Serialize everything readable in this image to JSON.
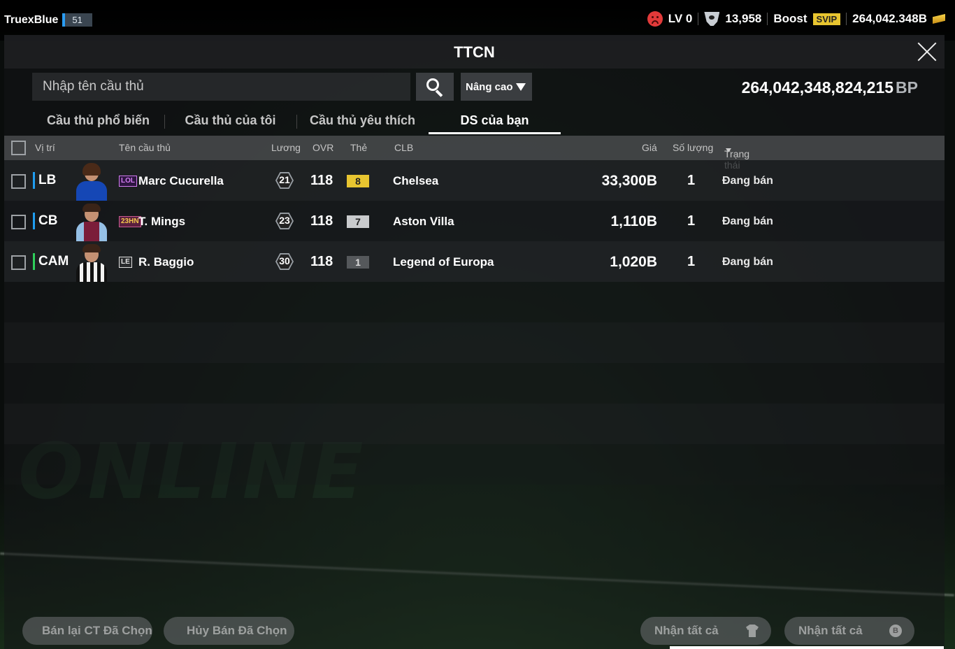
{
  "topbar": {
    "username": "TruexBlue",
    "user_level": "51",
    "lv": "LV 0",
    "trophies": "13,958",
    "boost_label": "Boost",
    "svip_label": "SVIP",
    "bp_short": "264,042.348B"
  },
  "panel": {
    "title": "TTCN",
    "search_placeholder": "Nhập tên cầu thủ",
    "advanced_label": "Nâng cao",
    "bp_total": "264,042,348,824,215",
    "bp_unit": "BP"
  },
  "tabs": [
    {
      "label": "Cầu thủ phổ biến"
    },
    {
      "label": "Cầu thủ của tôi"
    },
    {
      "label": "Cầu thủ yêu thích"
    },
    {
      "label": "DS của bạn"
    }
  ],
  "table": {
    "headers": {
      "position": "Vị trí",
      "name": "Tên cầu thủ",
      "salary": "Lương",
      "ovr": "OVR",
      "grade": "Thẻ",
      "club": "CLB",
      "price": "Giá",
      "quantity": "Số lượng",
      "status": "Trạng thái"
    },
    "rows": [
      {
        "position": "LB",
        "season": "LOL",
        "name": "Marc Cucurella",
        "salary": "21",
        "ovr": "118",
        "grade": "8",
        "club": "Chelsea",
        "price": "33,300B",
        "quantity": "1",
        "status": "Đang bán"
      },
      {
        "position": "CB",
        "season": "23HN",
        "name": "T. Mings",
        "salary": "23",
        "ovr": "118",
        "grade": "7",
        "club": "Aston Villa",
        "price": "1,110B",
        "quantity": "1",
        "status": "Đang bán"
      },
      {
        "position": "CAM",
        "season": "LE",
        "name": "R. Baggio",
        "salary": "30",
        "ovr": "118",
        "grade": "1",
        "club": "Legend of Europa",
        "price": "1,020B",
        "quantity": "1",
        "status": "Đang bán"
      }
    ]
  },
  "bottom": {
    "resell_label": "Bán lại CT Đã Chọn",
    "cancel_label": "Hủy Bán Đã Chọn",
    "receive_all_players": "Nhận tất cả",
    "receive_all_bp": "Nhận tất cả"
  },
  "colors": {
    "grade_8": "#e8c530",
    "grade_7": "#c9cbcd",
    "grade_1": "#55585b"
  }
}
